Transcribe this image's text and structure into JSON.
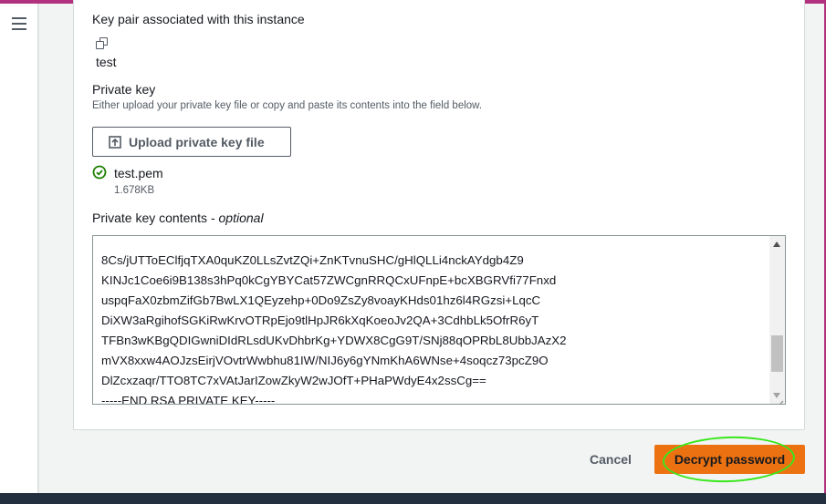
{
  "key_pair": {
    "label": "Key pair associated with this instance",
    "name": "test"
  },
  "private_key": {
    "label": "Private key",
    "description": "Either upload your private key file or copy and paste its contents into the field below.",
    "upload_button": "Upload private key file",
    "file_name": "test.pem",
    "file_size": "1.678KB"
  },
  "contents": {
    "label": "Private key contents -",
    "optional": "optional",
    "lines": [
      "8Cs/jUTToEClfjqTXA0quKZ0LLsZvtZQi+ZnKTvnuSHC/gHlQLLi4nckAYdgb4Z9",
      "KINJc1Coe6i9B138s3hPq0kCgYBYCat57ZWCgnRRQCxUFnpE+bcXBGRVfi77Fnxd",
      "uspqFaX0zbmZifGb7BwLX1QEyzehp+0Do9ZsZy8voayKHds01hz6l4RGzsi+LqcC",
      "DiXW3aRgihofSGKiRwKrvOTRpEjo9tlHpJR6kXqKoeoJv2QA+3CdhbLk5OfrR6yT",
      "TFBn3wKBgQDIGwniDIdRLsdUKvDhbrKg+YDWX8CgG9T/SNj88qOPRbL8UbbJAzX2",
      "mVX8xxw4AOJzsEirjVOvtrWwbhu81IW/NIJ6y6gYNmKhA6WNse+4soqcz73pcZ9O",
      "DlZcxzaqr/TTO8TC7xVAtJarIZowZkyW2wJOfT+PHaPWdyE4x2ssCg==",
      "-----END RSA PRIVATE KEY-----"
    ]
  },
  "actions": {
    "cancel": "Cancel",
    "decrypt": "Decrypt password"
  },
  "colors": {
    "primary_button": "#ec7211",
    "highlight_ring": "#39e81c",
    "success": "#1d8102"
  }
}
